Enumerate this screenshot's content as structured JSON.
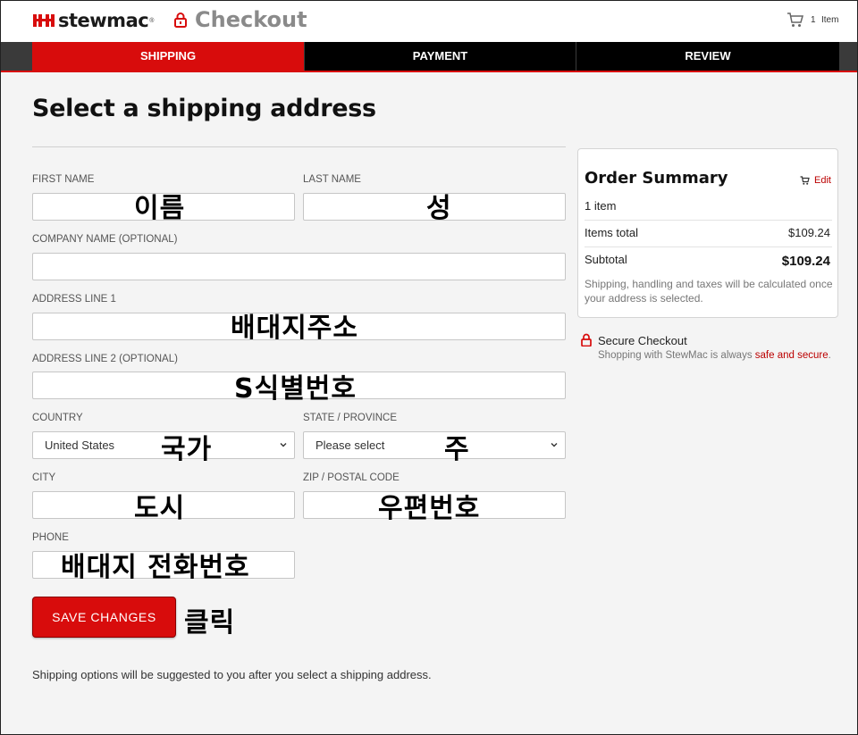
{
  "header": {
    "brand": "stewmac",
    "brand_reg": "®",
    "title": "Checkout",
    "cart_count": "1",
    "cart_label": "Item"
  },
  "steps": [
    {
      "label": "SHIPPING",
      "active": true
    },
    {
      "label": "PAYMENT",
      "active": false
    },
    {
      "label": "REVIEW",
      "active": false
    }
  ],
  "form": {
    "title": "Select a shipping address",
    "first_name_label": "FIRST NAME",
    "last_name_label": "LAST NAME",
    "company_label": "COMPANY NAME (OPTIONAL)",
    "address1_label": "ADDRESS LINE 1",
    "address2_label": "ADDRESS LINE 2 (OPTIONAL)",
    "country_label": "COUNTRY",
    "country_value": "United States",
    "state_label": "STATE / PROVINCE",
    "state_value": "Please select",
    "city_label": "CITY",
    "zip_label": "ZIP / POSTAL CODE",
    "phone_label": "PHONE",
    "save_label": "SAVE CHANGES",
    "note": "Shipping options will be suggested to you after you select a shipping address."
  },
  "annotations": {
    "first_name": "이름",
    "last_name": "성",
    "address1": "배대지주소",
    "address2": "S식별번호",
    "country": "국가",
    "state": "주",
    "city": "도시",
    "zip": "우편번호",
    "phone": "배대지 전화번호",
    "click": "클릭"
  },
  "summary": {
    "title": "Order Summary",
    "edit_label": "Edit",
    "item_count": "1 item",
    "items_total_label": "Items total",
    "items_total_value": "$109.24",
    "subtotal_label": "Subtotal",
    "subtotal_value": "$109.24",
    "note": "Shipping, handling and taxes will be calculated once your address is selected."
  },
  "secure": {
    "title": "Secure Checkout",
    "text": "Shopping with StewMac is always ",
    "link": "safe and secure",
    "end": "."
  },
  "colors": {
    "brand_red": "#d80c0c",
    "step_inactive": "#000000",
    "muted_title": "#8a8a8a"
  }
}
